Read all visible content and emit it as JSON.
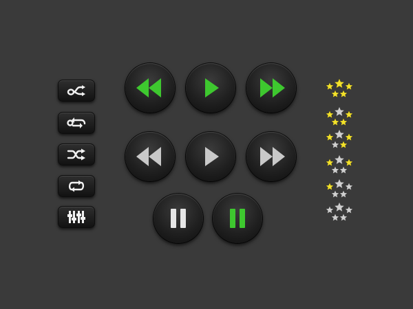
{
  "colors": {
    "background": "#3a3a3a",
    "green": "#3ec82f",
    "gray": "#c9c9c9",
    "white": "#f2f2f2",
    "star_on": "#f3e12a",
    "star_off": "#cfcfcf"
  },
  "left_buttons": [
    {
      "icon": "infinity-shuffle-icon",
      "name": "infinite-shuffle-button"
    },
    {
      "icon": "infinity-repeat-icon",
      "name": "infinite-repeat-button"
    },
    {
      "icon": "shuffle-icon",
      "name": "shuffle-button"
    },
    {
      "icon": "repeat-icon",
      "name": "repeat-button"
    },
    {
      "icon": "equalizer-icon",
      "name": "equalizer-button"
    }
  ],
  "media_rows": [
    {
      "style": "green",
      "buttons": [
        "rewind-icon",
        "play-icon",
        "fast-forward-icon"
      ]
    },
    {
      "style": "gray",
      "buttons": [
        "rewind-icon",
        "play-icon",
        "fast-forward-icon"
      ]
    },
    {
      "style": "mixed",
      "buttons": [
        "pause-icon-white",
        "pause-icon-green"
      ]
    }
  ],
  "ratings": [
    {
      "value": 5,
      "max": 5
    },
    {
      "value": 4,
      "max": 5
    },
    {
      "value": 3,
      "max": 5
    },
    {
      "value": 2,
      "max": 5
    },
    {
      "value": 1,
      "max": 5
    },
    {
      "value": 0,
      "max": 5
    }
  ]
}
